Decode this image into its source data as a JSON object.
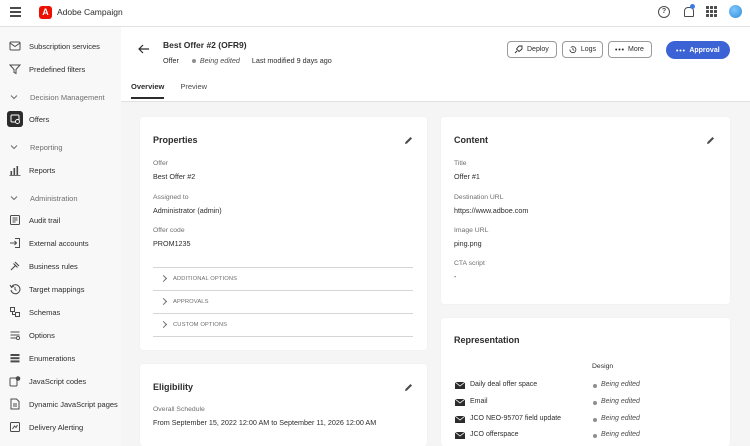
{
  "app": {
    "name": "Adobe Campaign",
    "logo_letter": "A"
  },
  "topbar": {
    "help_glyph": "?"
  },
  "sidebar": {
    "items": [
      {
        "label": "Subscription services",
        "icon": "subscription-icon",
        "type": "item"
      },
      {
        "label": "Predefined filters",
        "icon": "filter-icon",
        "type": "item"
      },
      {
        "label": "Decision Management",
        "type": "section"
      },
      {
        "label": "Offers",
        "icon": "offers-icon",
        "type": "item",
        "active": true
      },
      {
        "label": "Reporting",
        "type": "section"
      },
      {
        "label": "Reports",
        "icon": "reports-icon",
        "type": "item"
      },
      {
        "label": "Administration",
        "type": "section"
      },
      {
        "label": "Audit trail",
        "icon": "audit-icon",
        "type": "item"
      },
      {
        "label": "External accounts",
        "icon": "external-accounts-icon",
        "type": "item"
      },
      {
        "label": "Business rules",
        "icon": "business-rules-icon",
        "type": "item"
      },
      {
        "label": "Target mappings",
        "icon": "target-mappings-icon",
        "type": "item"
      },
      {
        "label": "Schemas",
        "icon": "schemas-icon",
        "type": "item"
      },
      {
        "label": "Options",
        "icon": "options-icon",
        "type": "item"
      },
      {
        "label": "Enumerations",
        "icon": "enumerations-icon",
        "type": "item"
      },
      {
        "label": "JavaScript codes",
        "icon": "js-codes-icon",
        "type": "item"
      },
      {
        "label": "Dynamic JavaScript pages",
        "icon": "js-pages-icon",
        "type": "item"
      },
      {
        "label": "Delivery Alerting",
        "icon": "alert-icon",
        "type": "item"
      }
    ]
  },
  "header": {
    "title": "Best Offer #2 (OFR9)",
    "type": "Offer",
    "status": "Being edited",
    "modified": "Last modified 9 days ago",
    "buttons": {
      "deploy": "Deploy",
      "logs": "Logs",
      "more": "More",
      "approval": "Approval"
    },
    "tabs": [
      "Overview",
      "Preview"
    ]
  },
  "properties": {
    "title": "Properties",
    "fields": [
      {
        "label": "Offer",
        "value": "Best Offer #2"
      },
      {
        "label": "Assigned to",
        "value": "Administrator (admin)"
      },
      {
        "label": "Offer code",
        "value": "PROM1235"
      }
    ],
    "accordions": [
      "ADDITIONAL OPTIONS",
      "APPROVALS",
      "CUSTOM OPTIONS"
    ]
  },
  "content": {
    "title": "Content",
    "fields": [
      {
        "label": "Title",
        "value": "Offer #1"
      },
      {
        "label": "Destination URL",
        "value": "https://www.adboe.com"
      },
      {
        "label": "Image URL",
        "value": "ping.png"
      },
      {
        "label": "CTA script",
        "value": "-"
      }
    ]
  },
  "eligibility": {
    "title": "Eligibility",
    "schedule_label": "Overall Schedule",
    "schedule_value": "From September 15, 2022 12:00 AM to September 11, 2026 12:00 AM"
  },
  "representation": {
    "title": "Representation",
    "column": "Design",
    "rows": [
      {
        "name": "Daily deal offer space",
        "status": "Being edited"
      },
      {
        "name": "Email",
        "status": "Being edited"
      },
      {
        "name": "JCO NEO-95707 field update",
        "status": "Being edited"
      },
      {
        "name": "JCO offerspace",
        "status": "Being edited"
      }
    ]
  },
  "colors": {
    "primary": "#3b63d6",
    "status_dot": "#8e8e8e",
    "logo": "#eb1000"
  }
}
